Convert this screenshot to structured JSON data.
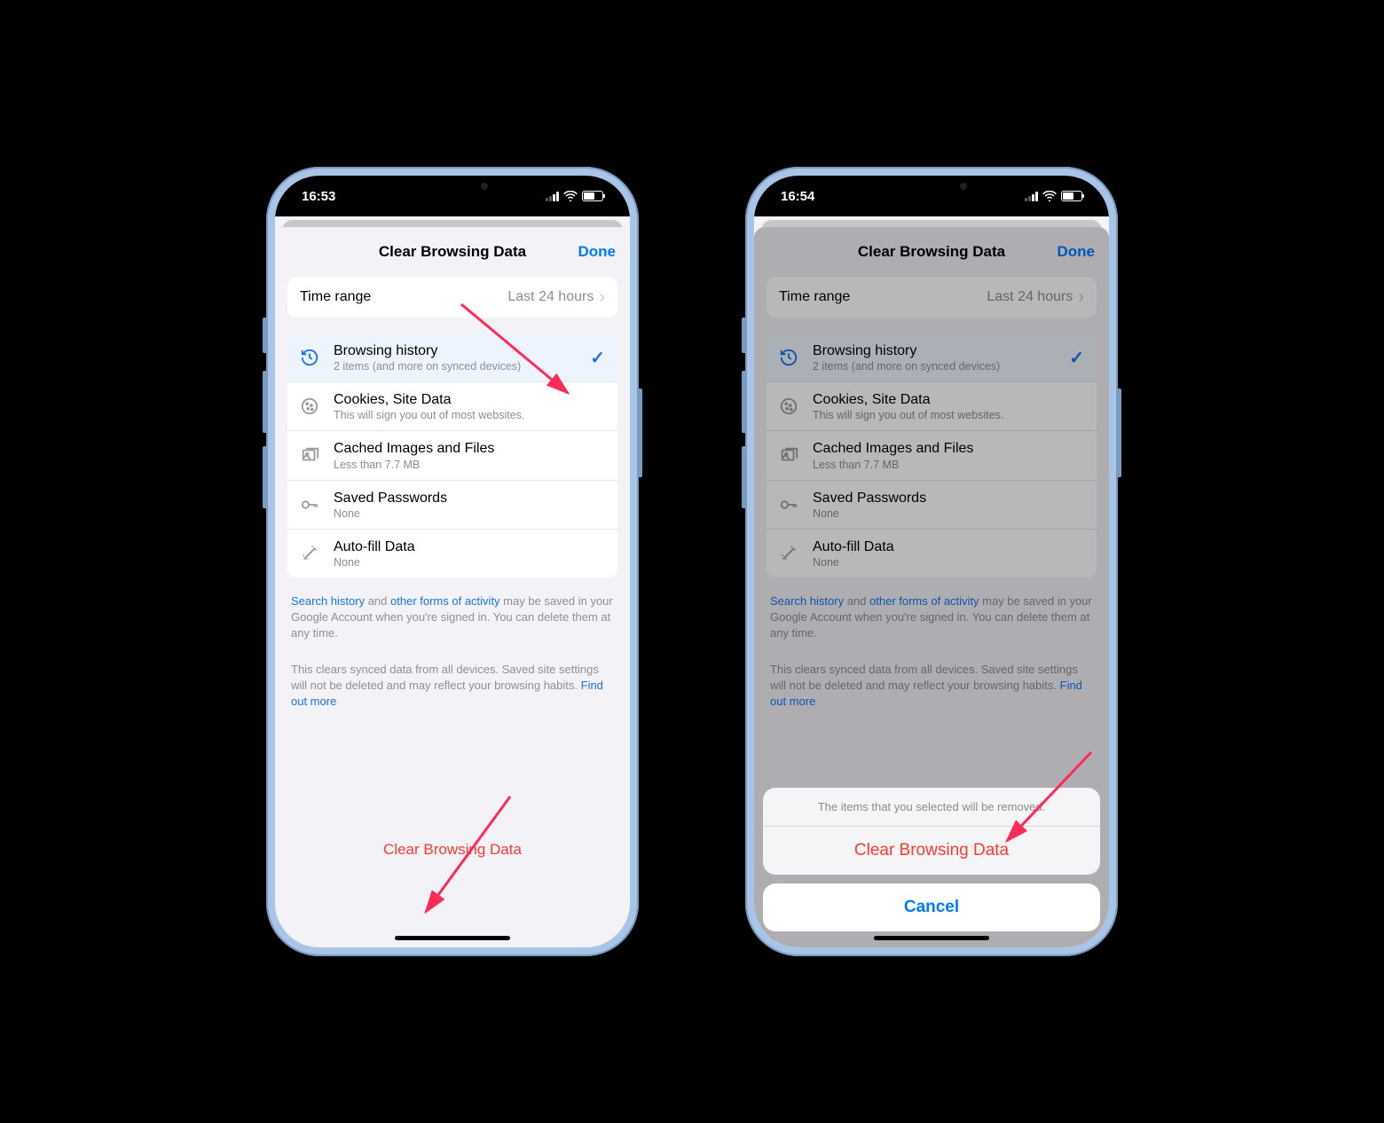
{
  "phone1": {
    "status_time": "16:53",
    "header_title": "Clear Browsing Data",
    "done_label": "Done",
    "time_range": {
      "label": "Time range",
      "value": "Last 24 hours"
    },
    "items": [
      {
        "title": "Browsing history",
        "sub": "2 items (and more on synced devices)",
        "selected": true,
        "icon": "history-icon"
      },
      {
        "title": "Cookies, Site Data",
        "sub": "This will sign you out of most websites.",
        "selected": false,
        "icon": "cookie-icon"
      },
      {
        "title": "Cached Images and Files",
        "sub": "Less than 7.7 MB",
        "selected": false,
        "icon": "image-stack-icon"
      },
      {
        "title": "Saved Passwords",
        "sub": "None",
        "selected": false,
        "icon": "key-icon"
      },
      {
        "title": "Auto-fill Data",
        "sub": "None",
        "selected": false,
        "icon": "wand-icon"
      }
    ],
    "footnote1": {
      "link1": "Search history",
      "mid1": " and ",
      "link2": "other forms of activity",
      "tail": " may be saved in your Google Account when you're signed in. You can delete them at any time."
    },
    "footnote2": {
      "text": "This clears synced data from all devices. Saved site settings will not be deleted and may reflect your browsing habits. ",
      "link": "Find out more"
    },
    "clear_button": "Clear Browsing Data"
  },
  "phone2": {
    "status_time": "16:54",
    "header_title": "Clear Browsing Data",
    "done_label": "Done",
    "time_range": {
      "label": "Time range",
      "value": "Last 24 hours"
    },
    "items": [
      {
        "title": "Browsing history",
        "sub": "2 items (and more on synced devices)",
        "selected": true,
        "icon": "history-icon"
      },
      {
        "title": "Cookies, Site Data",
        "sub": "This will sign you out of most websites.",
        "selected": false,
        "icon": "cookie-icon"
      },
      {
        "title": "Cached Images and Files",
        "sub": "Less than 7.7 MB",
        "selected": false,
        "icon": "image-stack-icon"
      },
      {
        "title": "Saved Passwords",
        "sub": "None",
        "selected": false,
        "icon": "key-icon"
      },
      {
        "title": "Auto-fill Data",
        "sub": "None",
        "selected": false,
        "icon": "wand-icon"
      }
    ],
    "footnote1": {
      "link1": "Search history",
      "mid1": " and ",
      "link2": "other forms of activity",
      "tail": " may be saved in your Google Account when you're signed in. You can delete them at any time."
    },
    "footnote2": {
      "text": "This clears synced data from all devices. Saved site settings will not be deleted and may reflect your browsing habits. ",
      "link": "Find out more"
    },
    "action_sheet": {
      "message": "The items that you selected will be removed.",
      "destructive": "Clear Browsing Data",
      "cancel": "Cancel"
    }
  }
}
